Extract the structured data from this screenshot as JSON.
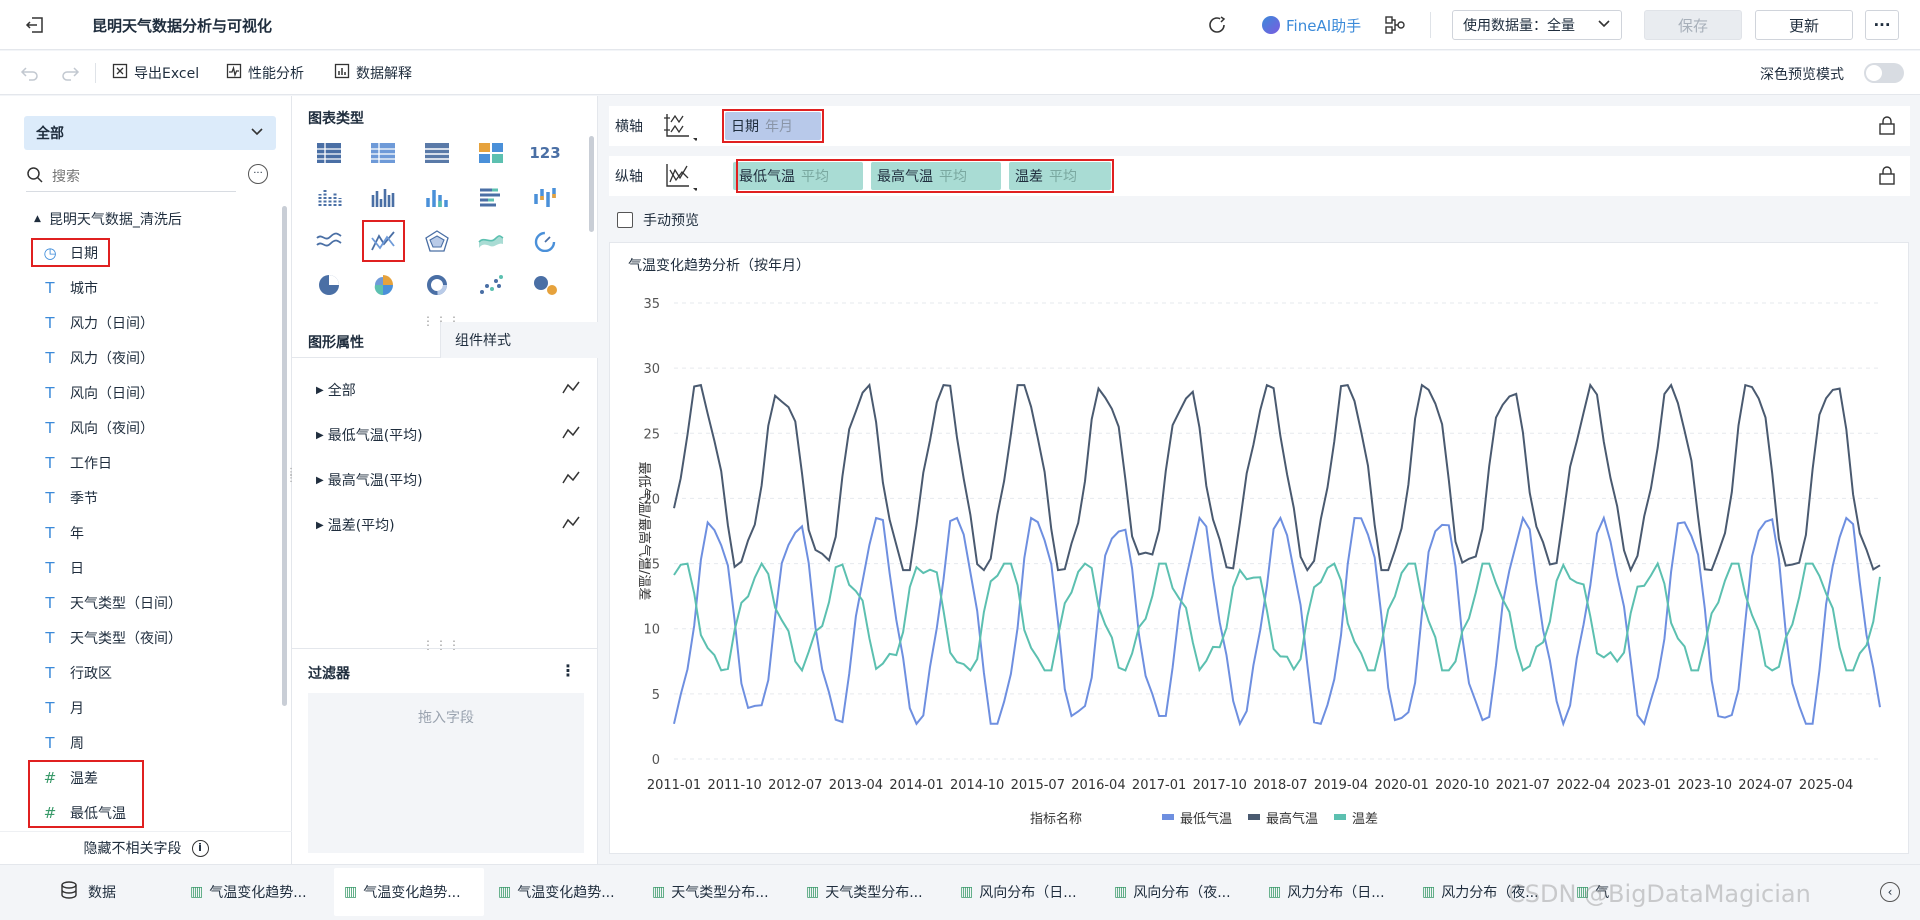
{
  "topbar": {
    "title": "昆明天气数据分析与可视化",
    "ai_assistant": "FineAI助手",
    "data_volume": "使用数据量：全量",
    "save": "保存",
    "update": "更新",
    "more": "···"
  },
  "toolbar": {
    "export_excel": "导出Excel",
    "perf_analysis": "性能分析",
    "data_explain": "数据解释",
    "dark_preview": "深色预览模式"
  },
  "left": {
    "dropdown": "全部",
    "search_placeholder": "搜索",
    "dataset": "昆明天气数据_清洗后",
    "fields": [
      {
        "type": "date",
        "label": "日期"
      },
      {
        "type": "text",
        "label": "城市"
      },
      {
        "type": "text",
        "label": "风力（日间）"
      },
      {
        "type": "text",
        "label": "风力（夜间）"
      },
      {
        "type": "text",
        "label": "风向（日间）"
      },
      {
        "type": "text",
        "label": "风向（夜间）"
      },
      {
        "type": "text",
        "label": "工作日"
      },
      {
        "type": "text",
        "label": "季节"
      },
      {
        "type": "text",
        "label": "年"
      },
      {
        "type": "text",
        "label": "日"
      },
      {
        "type": "text",
        "label": "天气类型（日间）"
      },
      {
        "type": "text",
        "label": "天气类型（夜间）"
      },
      {
        "type": "text",
        "label": "行政区"
      },
      {
        "type": "text",
        "label": "月"
      },
      {
        "type": "text",
        "label": "周"
      },
      {
        "type": "num",
        "label": "温差"
      },
      {
        "type": "num",
        "label": "最低气温"
      }
    ],
    "hide_fields": "隐藏不相关字段"
  },
  "middle": {
    "chart_type_title": "图表类型",
    "tab_properties": "图形属性",
    "tab_style": "组件样式",
    "props": [
      "全部",
      "最低气温(平均)",
      "最高气温(平均)",
      "温差(平均)"
    ],
    "filter_title": "过滤器",
    "filter_placeholder": "拖入字段"
  },
  "axes": {
    "x_label": "横轴",
    "y_label": "纵轴",
    "x_field": "日期",
    "x_agg": "年月",
    "y_fields": [
      {
        "name": "最低气温",
        "agg": "平均"
      },
      {
        "name": "最高气温",
        "agg": "平均"
      },
      {
        "name": "温差",
        "agg": "平均"
      }
    ],
    "manual_preview": "手动预览"
  },
  "chart_data": {
    "type": "line",
    "title": "气温变化趋势分析（按年月）",
    "ylabel": "最低气温/最高气温/温差",
    "ylim": [
      0,
      35
    ],
    "yticks": [
      0,
      5,
      10,
      15,
      20,
      25,
      30,
      35
    ],
    "xticks": [
      "2011-01",
      "2011-10",
      "2012-07",
      "2013-04",
      "2014-01",
      "2014-10",
      "2015-07",
      "2016-04",
      "2017-01",
      "2017-10",
      "2018-07",
      "2019-04",
      "2020-01",
      "2020-10",
      "2021-07",
      "2022-04",
      "2023-01",
      "2023-10",
      "2024-07",
      "2025-04"
    ],
    "x_start": "2011-01",
    "x_end": "2025-12",
    "legend_title": "指标名称",
    "legend_position": "bottom",
    "grid": true,
    "series": [
      {
        "name": "最低气温",
        "color": "#6e8fe0",
        "min": 2.7,
        "max": 18.5,
        "phase_month": 7
      },
      {
        "name": "最高气温",
        "color": "#4a5a70",
        "min": 14.5,
        "max": 28.7,
        "phase_month": 5
      },
      {
        "name": "温差",
        "color": "#5cc0b0",
        "min": 6.8,
        "max": 15.0,
        "phase_month": 2
      }
    ]
  },
  "tabs": {
    "data": "数据",
    "items": [
      "气温变化趋势...",
      "气温变化趋势...",
      "气温变化趋势...",
      "天气类型分布...",
      "天气类型分布...",
      "风向分布（日...",
      "风向分布（夜...",
      "风力分布（日...",
      "风力分布（夜...",
      "气"
    ],
    "watermark": "CSDN @BigDataMagician"
  },
  "colors": {
    "accent": "#3b8ad9",
    "red_highlight": "#e02020",
    "chip_x": "#b8c9ea",
    "chip_y": "#a9dcd4"
  }
}
